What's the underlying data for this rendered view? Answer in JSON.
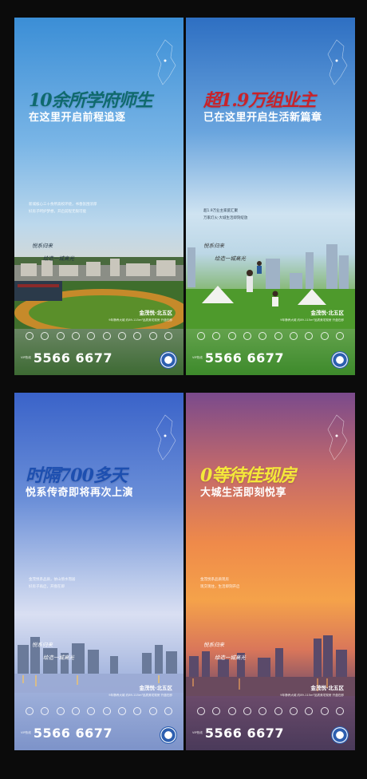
{
  "posters": [
    {
      "headline": "10余所学府师生",
      "subhead": "在这里开启前程追逐",
      "body": [
        "新城核心三十余所高校环绕，书香氛围浓厚",
        "好房子呵护梦想，开启前程无限可能"
      ],
      "slogan": [
        "悦系归来",
        "绘造一城高光"
      ],
      "location": "金茂悦·北五区",
      "location_sub": "9年静养大城 约89-115m²品质美宅现房 开盘在即",
      "phone_label": "VIP热线",
      "phone": "5566 6677"
    },
    {
      "headline": "超1.9万组业主",
      "subhead": "已在这里开启生活新篇章",
      "body": [
        "超1.9万业主家庭汇聚",
        "万家灯火·大城生活即刻绽放"
      ],
      "slogan": [
        "悦系归来",
        "绘造一城高光"
      ],
      "location": "金茂悦·北五区",
      "location_sub": "9年静养大城 约89-115m²品质美宅现房 开盘在即",
      "phone_label": "VIP热线",
      "phone": "5566 6677"
    },
    {
      "headline": "时隔700多天",
      "subhead": "悦系传奇即将再次上演",
      "body": [
        "金茂悦系品质，依山傍水而居",
        "好房子再启，开盘在即"
      ],
      "slogan": [
        "悦系归来",
        "绘造一城高光"
      ],
      "location": "金茂悦·北五区",
      "location_sub": "9年静养大城 约89-115m²品质美宅现房 开盘在即",
      "phone_label": "VIP热线",
      "phone": "5566 6677"
    },
    {
      "headline": "0等待佳现房",
      "subhead": "大城生活即刻悦享",
      "body": [
        "金茂悦系品质现房",
        "现交现住，生活即刻开启"
      ],
      "slogan": [
        "悦系归来",
        "绘造一城高光"
      ],
      "location": "金茂悦·北五区",
      "location_sub": "9年静养大城 约89-115m²品质美宅现房 开盘在即",
      "phone_label": "VIP热线",
      "phone": "5566 6677"
    }
  ]
}
